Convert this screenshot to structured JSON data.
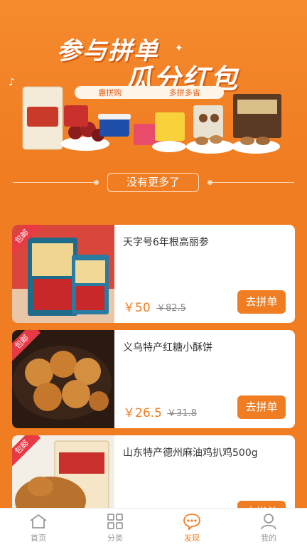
{
  "banner": {
    "title_line1": "参与拼单",
    "title_line2": "瓜分红包",
    "tag_left": "惠拼购",
    "tag_right": "多拼多省"
  },
  "divider": {
    "text": "没有更多了"
  },
  "products": [
    {
      "title": "天字号6年根高丽参",
      "price": "￥50",
      "orig_price": "￥82.5",
      "button": "去拼单",
      "badge": "包邮"
    },
    {
      "title": "义乌特产红糖小酥饼",
      "price": "￥26.5",
      "orig_price": "￥31.8",
      "button": "去拼单",
      "badge": "包邮"
    },
    {
      "title": "山东特产德州麻油鸡扒鸡500g",
      "price": "",
      "orig_price": "",
      "button": "去拼单",
      "badge": "包邮"
    }
  ],
  "tabbar": {
    "items": [
      {
        "label": "首页",
        "icon": "home-icon"
      },
      {
        "label": "分类",
        "icon": "category-grid-icon"
      },
      {
        "label": "发现",
        "icon": "discover-chat-icon"
      },
      {
        "label": "我的",
        "icon": "user-icon"
      }
    ],
    "active_index": 2
  },
  "colors": {
    "accent": "#f07d22",
    "badge": "#e83a44"
  }
}
